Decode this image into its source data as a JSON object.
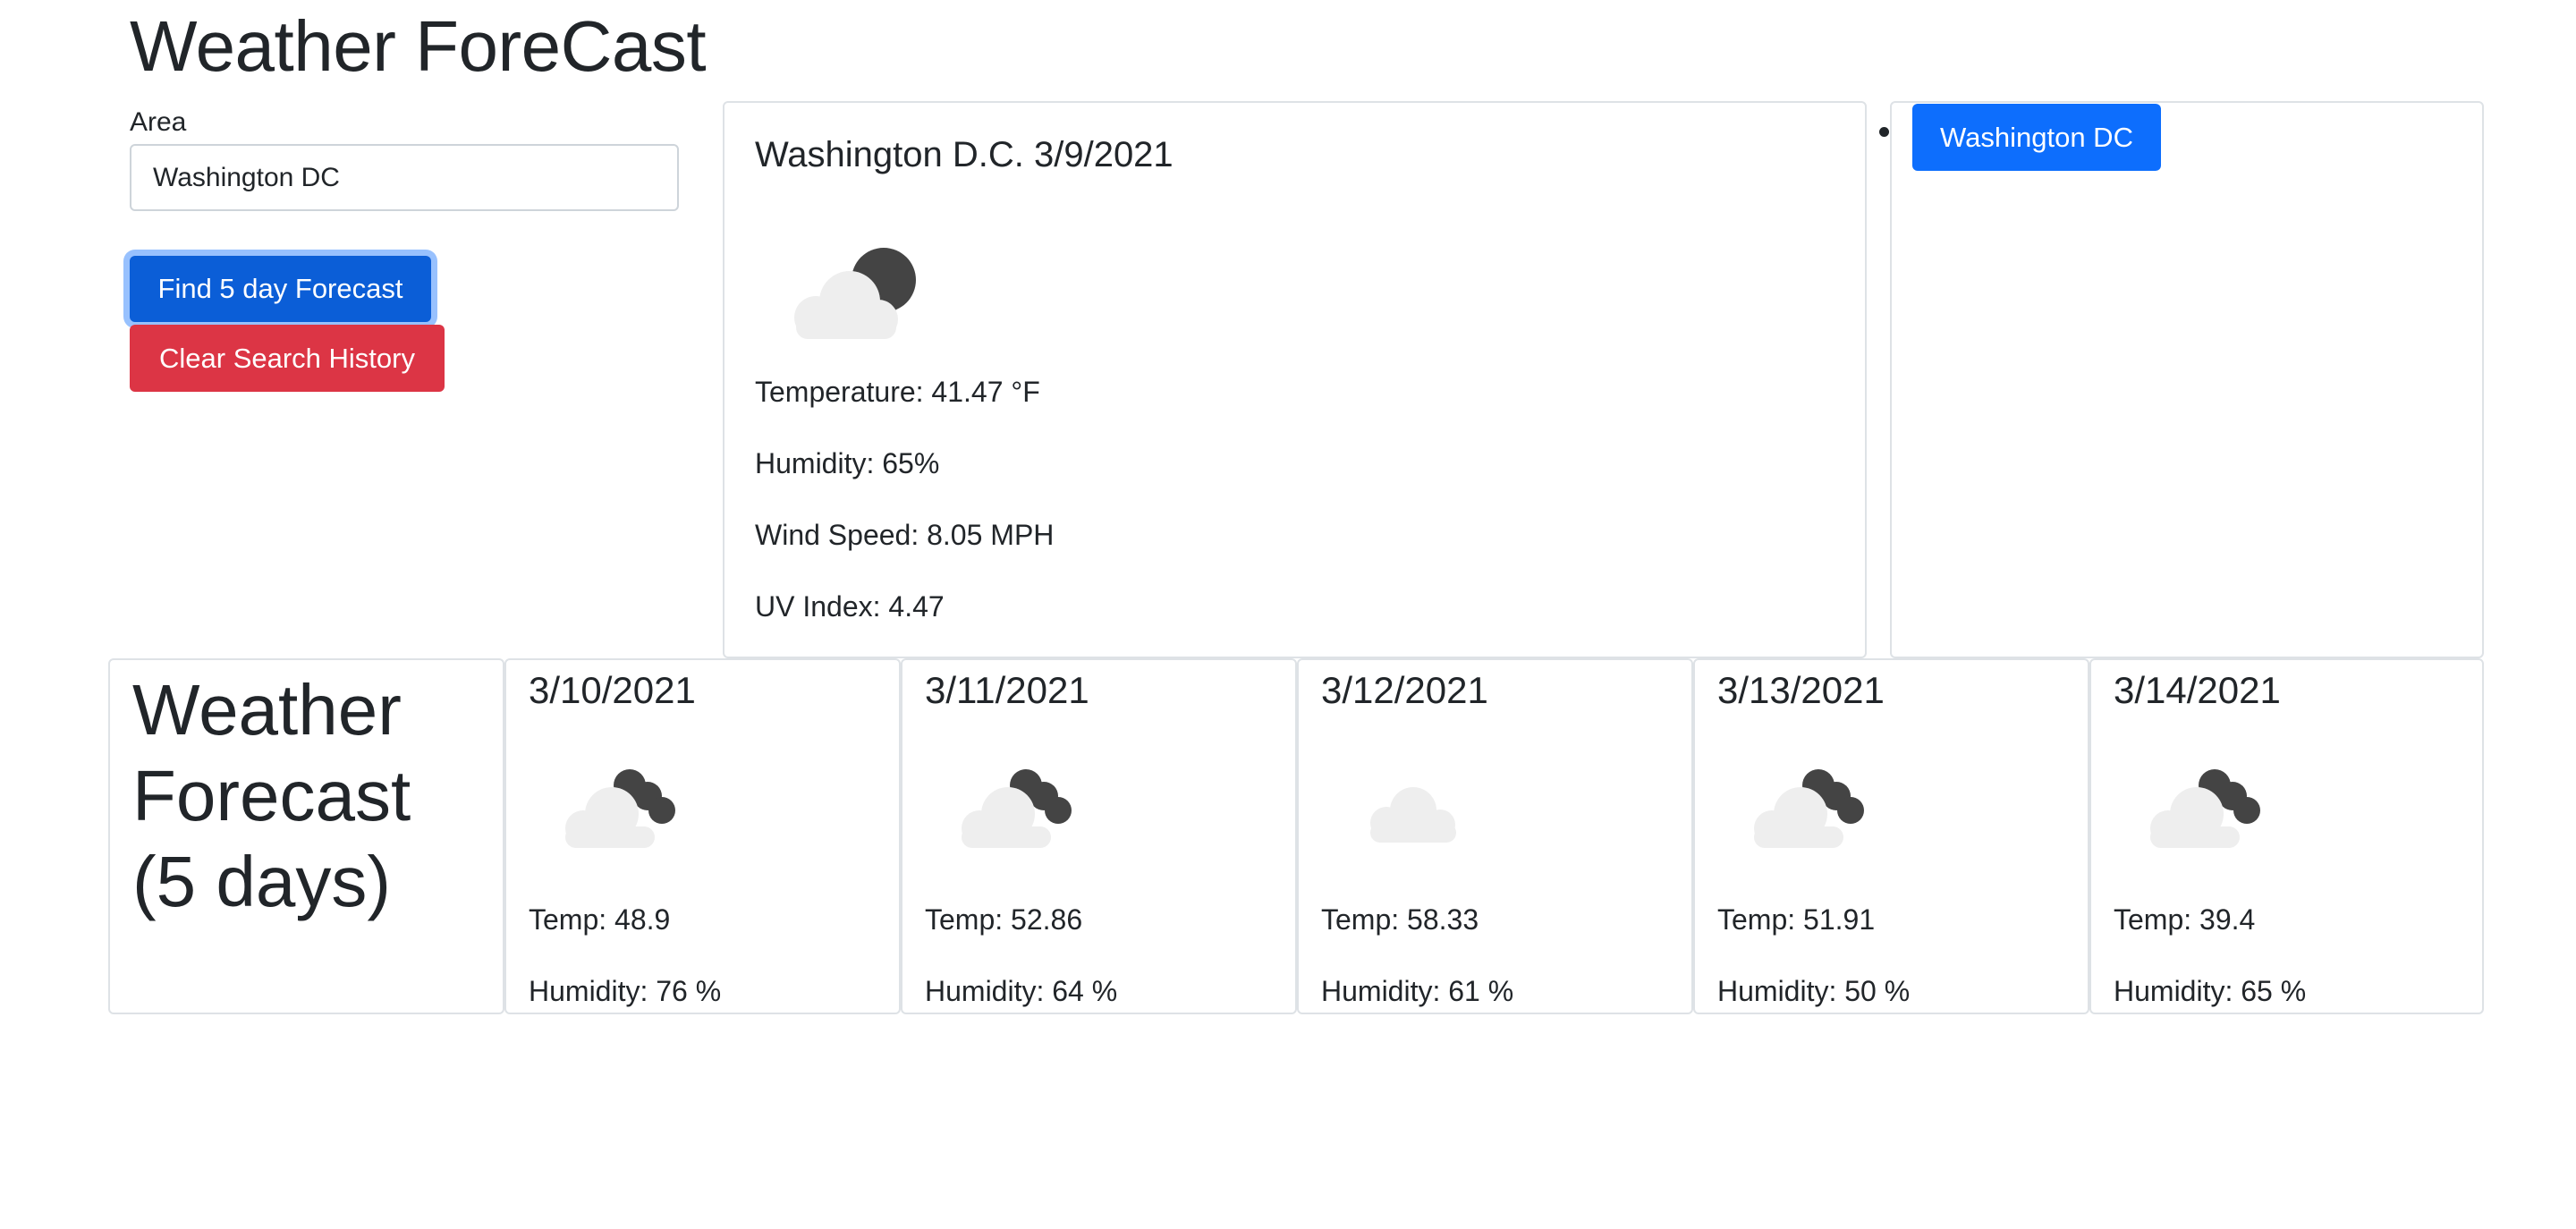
{
  "header": {
    "title": "Weather ForeCast"
  },
  "search": {
    "label": "Area",
    "value": "Washington DC",
    "find_button": "Find 5 day Forecast",
    "clear_button": "Clear Search History"
  },
  "current": {
    "title": "Washington D.C. 3/9/2021",
    "icon": "cloud-moon-icon",
    "temperature": "Temperature: 41.47 °F",
    "humidity": "Humidity: 65%",
    "wind": "Wind Speed: 8.05 MPH",
    "uv": "UV Index: 4.47"
  },
  "history": {
    "items": [
      "Washington DC"
    ]
  },
  "forecast": {
    "heading": "Weather Forecast (5 days)",
    "days": [
      {
        "date": "3/10/2021",
        "icon": "cloud-moon-icon",
        "temp": "Temp: 48.9",
        "humidity": "Humidity: 76 %"
      },
      {
        "date": "3/11/2021",
        "icon": "cloud-moon-icon",
        "temp": "Temp: 52.86",
        "humidity": "Humidity: 64 %"
      },
      {
        "date": "3/12/2021",
        "icon": "cloud-icon",
        "temp": "Temp: 58.33",
        "humidity": "Humidity: 61 %"
      },
      {
        "date": "3/13/2021",
        "icon": "cloud-moon-icon",
        "temp": "Temp: 51.91",
        "humidity": "Humidity: 50 %"
      },
      {
        "date": "3/14/2021",
        "icon": "cloud-moon-icon",
        "temp": "Temp: 39.4",
        "humidity": "Humidity: 65 %"
      }
    ]
  },
  "colors": {
    "primary": "#0d6efd",
    "primary_active": "#0b5ed7",
    "danger": "#dc3545",
    "border": "#dee2e6",
    "text": "#212529"
  }
}
